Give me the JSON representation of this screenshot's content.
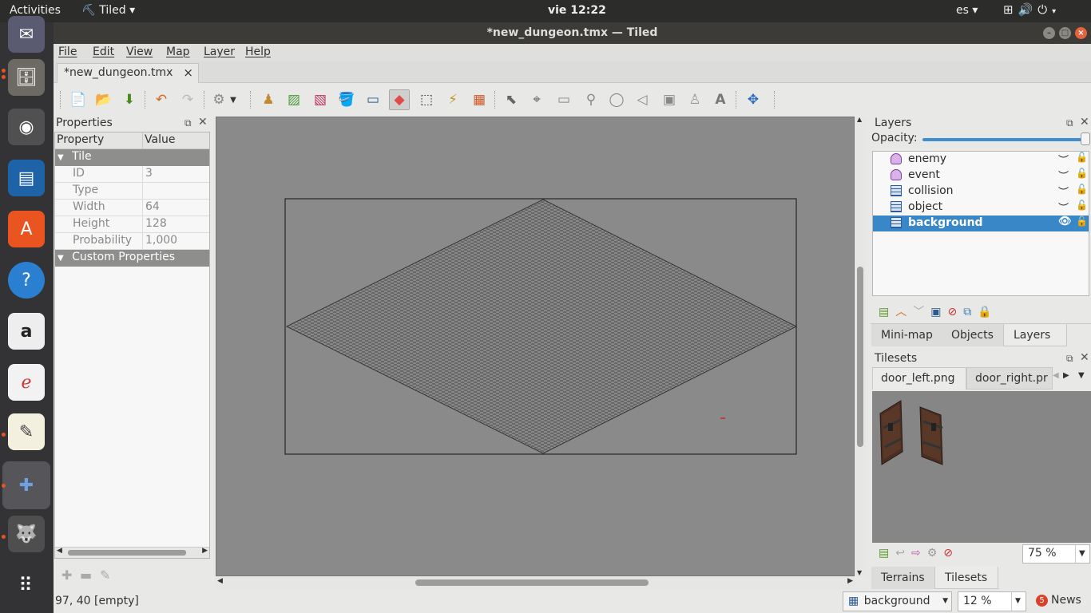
{
  "topbar": {
    "activities": "Activities",
    "app_name": "Tiled",
    "app_menu_arrow": "▾",
    "clock": "vie 12:22",
    "language": "es",
    "language_arrow": "▾",
    "tray_icons": [
      "network-icon",
      "volume-icon",
      "power-icon"
    ]
  },
  "dock": {
    "items": [
      "thunderbird-icon",
      "files-icon",
      "rhythmbox-icon",
      "writer-icon",
      "software-center-icon",
      "help-icon",
      "amazon-icon",
      "document-viewer-icon",
      "text-editor-icon",
      "tiled-icon",
      "gimp-icon",
      "show-apps-icon"
    ]
  },
  "window": {
    "title": "*new_dungeon.tmx — Tiled",
    "controls": [
      "minimize",
      "maximize",
      "close"
    ]
  },
  "menubar": [
    "File",
    "Edit",
    "View",
    "Map",
    "Layer",
    "Help"
  ],
  "document_tab": {
    "label": "*new_dungeon.tmx",
    "close": "×"
  },
  "properties": {
    "title": "Properties",
    "col_property": "Property",
    "col_value": "Value",
    "group_tile": "Tile",
    "rows": [
      {
        "name": "ID",
        "value": "3"
      },
      {
        "name": "Type",
        "value": ""
      },
      {
        "name": "Width",
        "value": "64"
      },
      {
        "name": "Height",
        "value": "128"
      },
      {
        "name": "Probability",
        "value": "1,000"
      }
    ],
    "group_custom": "Custom Properties"
  },
  "layers": {
    "title": "Layers",
    "opacity_label": "Opacity:",
    "opacity": 1.0,
    "items": [
      {
        "name": "enemy",
        "type": "object",
        "selected": false
      },
      {
        "name": "event",
        "type": "object",
        "selected": false
      },
      {
        "name": "collision",
        "type": "tile",
        "selected": false
      },
      {
        "name": "object",
        "type": "tile",
        "selected": false
      },
      {
        "name": "background",
        "type": "tile",
        "selected": true
      }
    ]
  },
  "dock_tabs_top": [
    "Mini-map",
    "Objects",
    "Layers"
  ],
  "dock_tabs_top_active": "Layers",
  "tilesets": {
    "title": "Tilesets",
    "tabs": [
      "door_left.png",
      "door_right.pr"
    ],
    "zoom": "75 %"
  },
  "dock_tabs_bottom": [
    "Terrains",
    "Tilesets"
  ],
  "dock_tabs_bottom_active": "Tilesets",
  "statusbar": {
    "coords": "97, 40 [empty]",
    "current_layer": "background",
    "zoom": "12 %",
    "news_count": "5",
    "news_label": "News"
  }
}
